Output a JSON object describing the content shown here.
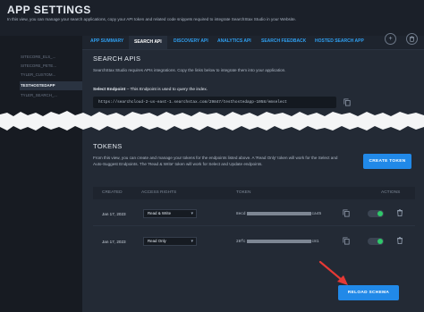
{
  "header": {
    "title": "APP SETTINGS",
    "subtitle": "In this view, you can manage your search applications, copy your API token and related code snippets required to integrate SearchStax Studio in your Website."
  },
  "sidebar": {
    "items": [
      {
        "label": "SITECORE_ELS_..."
      },
      {
        "label": "SITECORE_PETE..."
      },
      {
        "label": "TYLER_CUSTOM..."
      },
      {
        "label": "TESTHOSTEDAPP"
      },
      {
        "label": "TYLER_SEARCH_..."
      }
    ]
  },
  "tabs": [
    {
      "label": "APP SUMMARY"
    },
    {
      "label": "SEARCH API"
    },
    {
      "label": "DISCOVERY API"
    },
    {
      "label": "ANALYTICS API"
    },
    {
      "label": "SEARCH FEEDBACK"
    },
    {
      "label": "HOSTED SEARCH APP"
    }
  ],
  "toolbar": {
    "add_icon": "plus-icon",
    "delete_icon": "trash-icon"
  },
  "search_apis": {
    "title": "SEARCH APIS",
    "description": "SearchStax Studio requires APIs integrations. Copy the links below to integrate them into your application.",
    "endpoint_label": "Select Endpoint",
    "endpoint_note": " – This Endpoint is used to query the index.",
    "endpoint_value": "https://searchcloud-2-us-east-1.searchstax.com/29847/testhostedapp-1058/emselect"
  },
  "tokens": {
    "title": "TOKENS",
    "description": "From this view, you can create and manage your tokens for the endpoints listed above. A 'Read Only' token will work for the Select and Auto-Suggest Endpoints. The 'Read & Write' token will work for Select and Update endpoints.",
    "create_button": "CREATE TOKEN",
    "columns": {
      "created": "CREATED",
      "access": "ACCESS RIGHTS",
      "token": "TOKEN",
      "actions": "ACTIONS"
    },
    "rows": [
      {
        "created": "Jan 17, 2023",
        "access": "Read & Write",
        "token_start": "8ecd",
        "token_end": "ca45"
      },
      {
        "created": "Jan 17, 2023",
        "access": "Read Only",
        "token_start": "28fc",
        "token_end": "c81"
      }
    ]
  },
  "footer": {
    "reload_button": "RELOAD SCHEMA"
  },
  "colors": {
    "accent": "#2189e8",
    "background": "#1b2029",
    "panel": "#232a35",
    "annotation_arrow": "#e53935",
    "toggle_on": "#2fc86a"
  }
}
